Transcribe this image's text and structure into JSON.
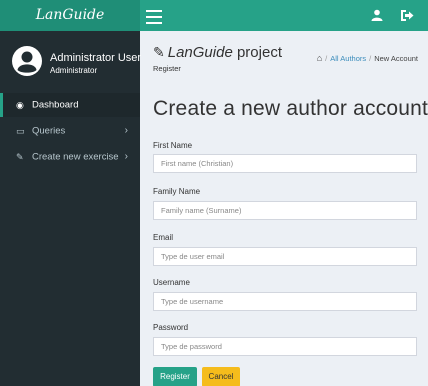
{
  "app": {
    "brand": "LanGuide"
  },
  "sidebar": {
    "user_name": "Administrator User",
    "user_role": "Administrator",
    "items": [
      {
        "label": "Dashboard",
        "icon": "dashboard-icon"
      },
      {
        "label": "Queries",
        "icon": "laptop-icon"
      },
      {
        "label": "Create new exercise",
        "icon": "edit-icon"
      }
    ]
  },
  "header": {
    "title_italic": "LanGuide",
    "title_rest": " project",
    "subtitle": "Register",
    "breadcrumb": {
      "link": "All Authors",
      "current": "New Account"
    }
  },
  "form": {
    "title": "Create a new author account",
    "fields": [
      {
        "label": "First Name",
        "placeholder": "First name (Christian)"
      },
      {
        "label": "Family Name",
        "placeholder": "Family name (Surname)"
      },
      {
        "label": "Email",
        "placeholder": "Type de user email"
      },
      {
        "label": "Username",
        "placeholder": "Type de username"
      },
      {
        "label": "Password",
        "placeholder": "Type de password"
      }
    ],
    "register_label": "Register",
    "cancel_label": "Cancel"
  },
  "colors": {
    "accent": "#26a288",
    "sidebar": "#222d32",
    "cancel": "#f5bc1c",
    "link": "#3c8dbc"
  }
}
